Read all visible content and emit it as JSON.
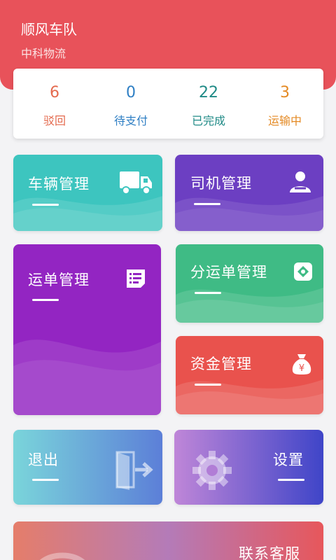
{
  "header": {
    "title": "顺风车队",
    "company": "中科物流",
    "bg_color": "#e8525a"
  },
  "stats": [
    {
      "value": "6",
      "label": "驳回",
      "color": "#e46a4e"
    },
    {
      "value": "0",
      "label": "待支付",
      "color": "#2f7fc4"
    },
    {
      "value": "22",
      "label": "已完成",
      "color": "#1f8a86"
    },
    {
      "value": "3",
      "label": "运输中",
      "color": "#e48a24"
    }
  ],
  "tiles": {
    "vehicle": {
      "label": "车辆管理",
      "icon": "truck-icon",
      "color": "#3dc5bf"
    },
    "driver": {
      "label": "司机管理",
      "icon": "driver-icon",
      "color": "#6c3fc2"
    },
    "waybill": {
      "label": "运单管理",
      "icon": "document-list-icon",
      "color": "#9325c2"
    },
    "sub_waybill": {
      "label": "分运单管理",
      "icon": "split-order-icon",
      "color": "#3fbb85"
    },
    "fund": {
      "label": "资金管理",
      "icon": "money-bag-icon",
      "color": "#e9524d"
    },
    "exit": {
      "label": "退出",
      "icon": "exit-door-icon"
    },
    "settings": {
      "label": "设置",
      "icon": "gear-icon"
    },
    "service": {
      "label": "联系客服",
      "icon": "headset-icon"
    }
  }
}
